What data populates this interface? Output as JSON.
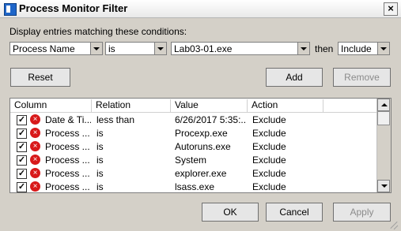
{
  "window": {
    "title": "Process Monitor Filter",
    "close_symbol": "×"
  },
  "filter": {
    "prompt": "Display entries matching these conditions:",
    "column": "Process Name",
    "relation": "is",
    "value": "Lab03-01.exe",
    "then_label": "then",
    "action": "Include"
  },
  "buttons": {
    "reset": "Reset",
    "add": "Add",
    "remove": "Remove",
    "ok": "OK",
    "cancel": "Cancel",
    "apply": "Apply"
  },
  "list": {
    "headers": [
      "Column",
      "Relation",
      "Value",
      "Action"
    ],
    "rows": [
      {
        "column": "Date & Ti...",
        "relation": "less than",
        "value": "6/26/2017 5:35:...",
        "action": "Exclude"
      },
      {
        "column": "Process ...",
        "relation": "is",
        "value": "Procexp.exe",
        "action": "Exclude"
      },
      {
        "column": "Process ...",
        "relation": "is",
        "value": "Autoruns.exe",
        "action": "Exclude"
      },
      {
        "column": "Process ...",
        "relation": "is",
        "value": "System",
        "action": "Exclude"
      },
      {
        "column": "Process ...",
        "relation": "is",
        "value": "explorer.exe",
        "action": "Exclude"
      },
      {
        "column": "Process ...",
        "relation": "is",
        "value": "lsass.exe",
        "action": "Exclude"
      }
    ],
    "check_symbol": "✓",
    "error_symbol": "×"
  },
  "colors": {
    "title_bar": "#ffffff",
    "dialog_bg": "#d4d0c8",
    "error_icon": "#d8191a"
  }
}
